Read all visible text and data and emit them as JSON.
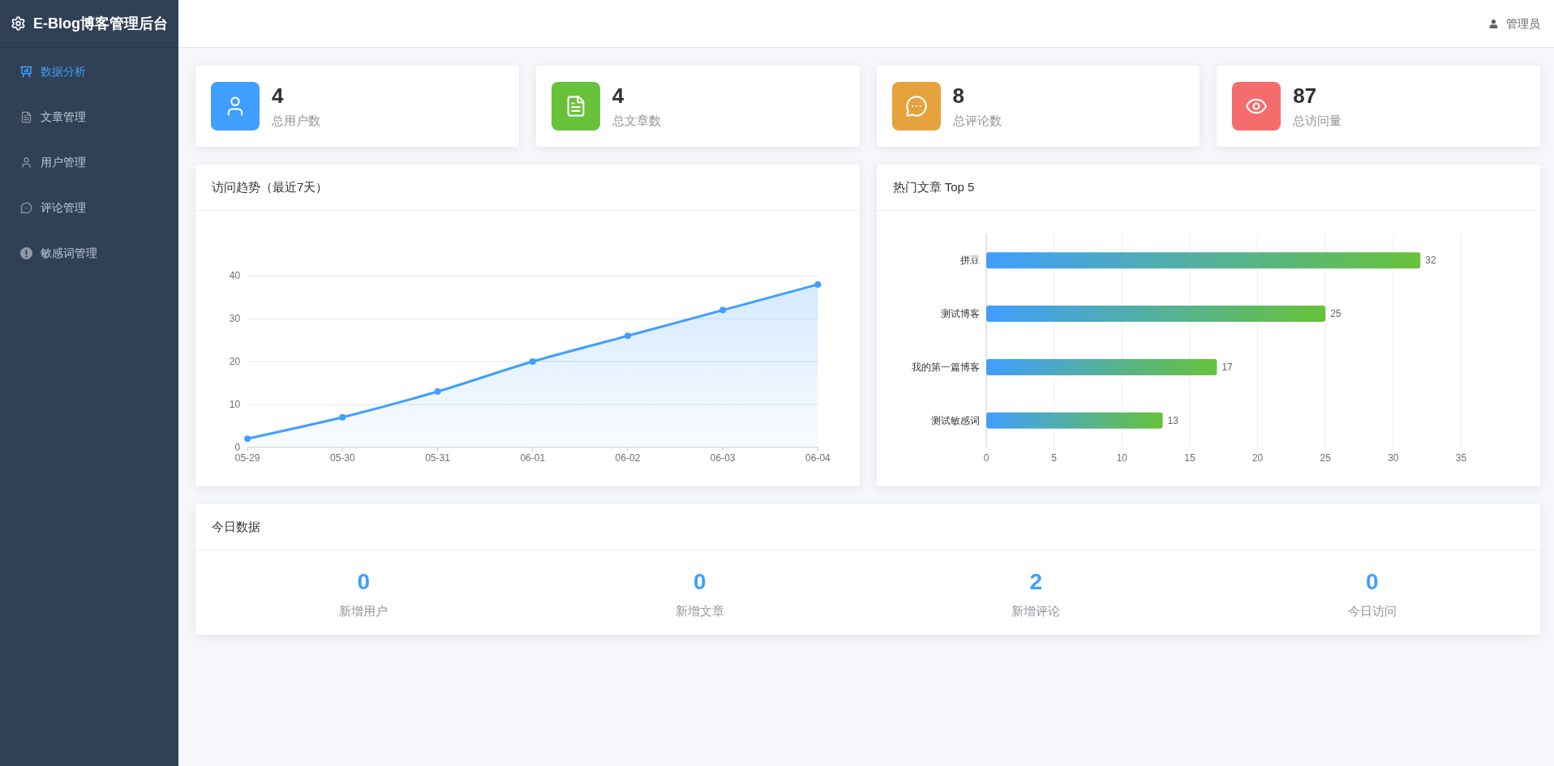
{
  "sidebar": {
    "title": "E-Blog博客管理后台",
    "items": [
      {
        "label": "数据分析",
        "selected": true
      },
      {
        "label": "文章管理",
        "selected": false
      },
      {
        "label": "用户管理",
        "selected": false
      },
      {
        "label": "评论管理",
        "selected": false
      },
      {
        "label": "敏感词管理",
        "selected": false
      }
    ]
  },
  "header": {
    "user": "管理员"
  },
  "stats": [
    {
      "value": "4",
      "label": "总用户数",
      "color": "#409eff"
    },
    {
      "value": "4",
      "label": "总文章数",
      "color": "#67c23a"
    },
    {
      "value": "8",
      "label": "总评论数",
      "color": "#e6a23c"
    },
    {
      "value": "87",
      "label": "总访问量",
      "color": "#f56c6c"
    }
  ],
  "visit_trend": {
    "title": "访问趋势（最近7天）",
    "chart_data": {
      "type": "area",
      "categories": [
        "05-29",
        "05-30",
        "05-31",
        "06-01",
        "06-02",
        "06-03",
        "06-04"
      ],
      "series": [
        {
          "color": "#409eff",
          "values": [
            2,
            7,
            13,
            20,
            26,
            32,
            38
          ]
        }
      ],
      "ylim": [
        0,
        40
      ],
      "yticks": [
        0,
        10,
        20,
        30,
        40
      ],
      "grid": true
    }
  },
  "hot_articles": {
    "title": "热门文章 Top 5",
    "chart_data": {
      "type": "bar",
      "orientation": "horizontal",
      "categories": [
        "拼豆",
        "测试博客",
        "我的第一篇博客",
        "测试敏感词"
      ],
      "values": [
        32,
        25,
        17,
        13
      ],
      "xlim": [
        0,
        35
      ],
      "xticks": [
        0,
        5,
        10,
        15,
        20,
        25,
        30,
        35
      ],
      "data_labels": true,
      "grid": true
    }
  },
  "today": {
    "title": "今日数据",
    "items": [
      {
        "value": "0",
        "label": "新增用户"
      },
      {
        "value": "0",
        "label": "新增文章"
      },
      {
        "value": "2",
        "label": "新增评论"
      },
      {
        "value": "0",
        "label": "今日访问"
      }
    ]
  }
}
